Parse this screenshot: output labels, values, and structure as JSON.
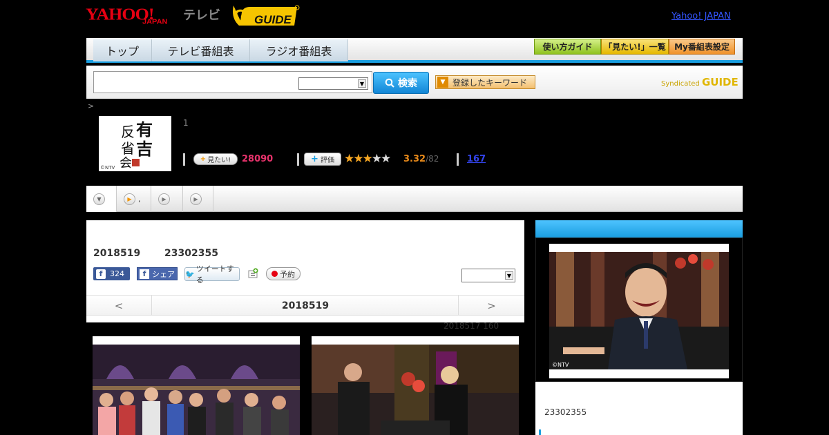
{
  "header": {
    "yahoo_logo": "YAHOO!",
    "yahoo_sub": "JAPAN",
    "tv_label": "テレビ",
    "gguide_logo": "G-GUIDE",
    "yahoo_link": "Yahoo! JAPAN"
  },
  "nav": {
    "tabs": [
      "トップ",
      "テレビ番組表",
      "ラジオ番組表"
    ],
    "buttons": [
      "使い方ガイド",
      "「見たい!」一覧",
      "My番組表設定"
    ]
  },
  "search": {
    "placeholder": "",
    "button_label": "検索",
    "keyword_button": "登録したキーワード",
    "syndicated_label": "Syndicated",
    "syndicated_logo": "GUIDE"
  },
  "breadcrumb": ">",
  "program": {
    "image_label": "有吉反省会",
    "image_credit": "©NTV",
    "episode_number": "1",
    "mitai_label": "見たい!",
    "mitai_count": "28090",
    "hyoka_label": "評価",
    "stars_filled": 3,
    "stars_total": 5,
    "rating": "3.32",
    "rating_of": "/82",
    "review_count": "167"
  },
  "tabs": [
    {
      "name": "tab-overview",
      "label": ""
    },
    {
      "name": "tab-broadcast",
      "label": ","
    },
    {
      "name": "tab-cast",
      "label": ""
    },
    {
      "name": "tab-reviews",
      "label": ""
    }
  ],
  "content": {
    "air_date": "2018519",
    "air_time": "23302355",
    "fb_count": "324",
    "share_label": "シェア",
    "tweet_label": "ツイートする",
    "reserve_label": "予約",
    "date_nav": {
      "prev": "<",
      "current": "2018519",
      "next": ">"
    },
    "updated": "2018517  160"
  },
  "sidebar": {
    "image_credit": "©NTV",
    "time": "23302355"
  }
}
